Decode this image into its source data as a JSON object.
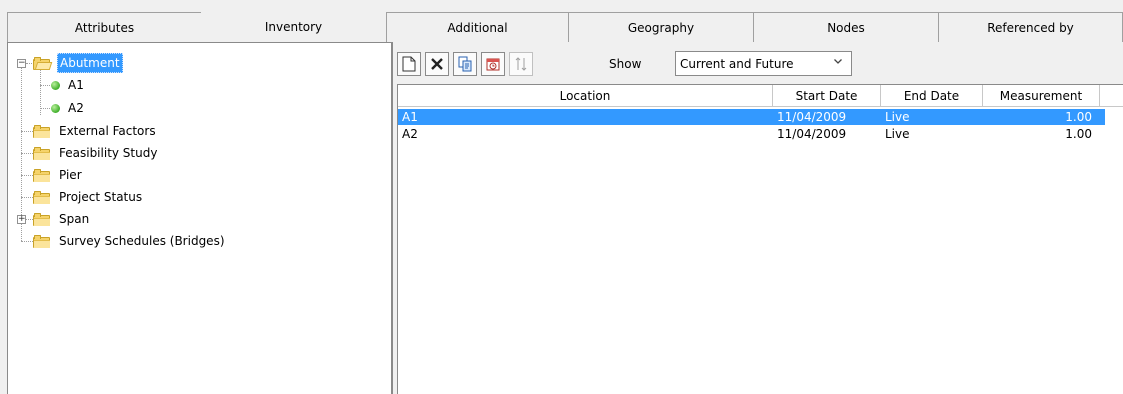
{
  "left_tabs": [
    {
      "label": "Attributes",
      "active": false
    },
    {
      "label": "Inventory",
      "active": true
    }
  ],
  "right_tabs": [
    {
      "label": "Additional"
    },
    {
      "label": "Geography"
    },
    {
      "label": "Nodes"
    },
    {
      "label": "Referenced by"
    }
  ],
  "tree": {
    "abutment": {
      "label": "Abutment",
      "expanded": true,
      "selected": true,
      "icon": "open-folder-icon"
    },
    "a1": {
      "label": "A1",
      "icon": "green-dot-icon"
    },
    "a2": {
      "label": "A2",
      "icon": "green-dot-icon"
    },
    "external_factors": {
      "label": "External Factors",
      "icon": "folder-icon"
    },
    "feasibility_study": {
      "label": "Feasibility Study",
      "icon": "folder-icon"
    },
    "pier": {
      "label": "Pier",
      "icon": "folder-icon"
    },
    "project_status": {
      "label": "Project Status",
      "icon": "folder-icon"
    },
    "span": {
      "label": "Span",
      "expandable": true,
      "icon": "folder-icon"
    },
    "survey_schedules": {
      "label": "Survey Schedules (Bridges)",
      "icon": "folder-icon"
    }
  },
  "toolbar": {
    "buttons": [
      "new-document-icon",
      "delete-icon",
      "copy-icon",
      "history-icon",
      "sort-icon"
    ],
    "show_label": "Show",
    "show_value": "Current and Future"
  },
  "grid": {
    "columns": [
      "Location",
      "Start Date",
      "End Date",
      "Measurement"
    ],
    "rows": [
      {
        "location": "A1",
        "start": "11/04/2009",
        "end": "Live",
        "measurement": "1.00",
        "selected": true
      },
      {
        "location": "A2",
        "start": "11/04/2009",
        "end": "Live",
        "measurement": "1.00",
        "selected": false
      }
    ]
  },
  "colors": {
    "selection": "#3399ff",
    "folder": "#f5d36b",
    "status_dot": "#3fae2a"
  }
}
